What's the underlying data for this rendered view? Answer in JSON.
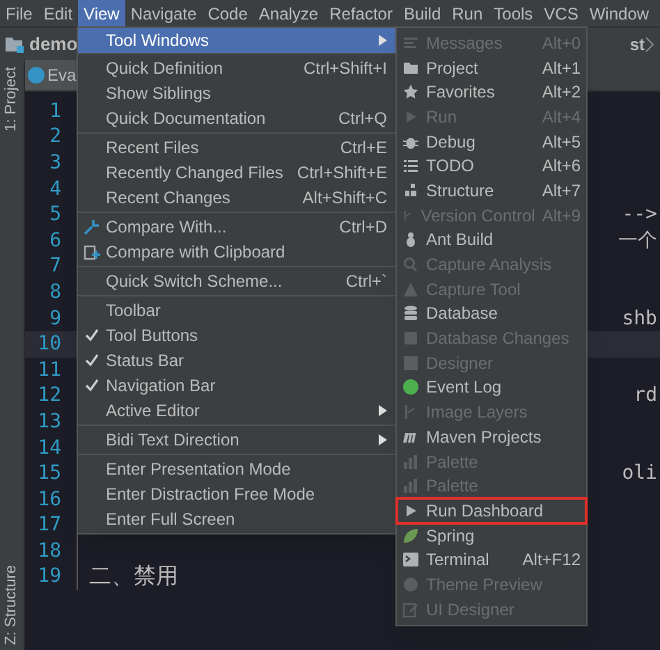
{
  "menu_bar": [
    {
      "label": "File",
      "selected": false
    },
    {
      "label": "Edit",
      "selected": false
    },
    {
      "label": "View",
      "selected": true
    },
    {
      "label": "Navigate",
      "selected": false
    },
    {
      "label": "Code",
      "selected": false
    },
    {
      "label": "Analyze",
      "selected": false
    },
    {
      "label": "Refactor",
      "selected": false
    },
    {
      "label": "Build",
      "selected": false
    },
    {
      "label": "Run",
      "selected": false
    },
    {
      "label": "Tools",
      "selected": false
    },
    {
      "label": "VCS",
      "selected": false
    },
    {
      "label": "Window",
      "selected": false
    }
  ],
  "toolbar": {
    "project": "demo",
    "breadcrumb": "st"
  },
  "side_tabs": {
    "top": "1: Project",
    "bottom": "Z: Structure"
  },
  "editor_tab": {
    "label": "Eva"
  },
  "code_lines": [
    {
      "number": "1",
      "current": false
    },
    {
      "number": "2",
      "current": false
    },
    {
      "number": "3",
      "current": false
    },
    {
      "number": "4",
      "current": false
    },
    {
      "number": "5",
      "text": "-->",
      "current": false,
      "kind": "tail"
    },
    {
      "number": "6",
      "text": "一个",
      "current": false,
      "kind": "tail"
    },
    {
      "number": "7",
      "current": false
    },
    {
      "number": "8",
      "current": false
    },
    {
      "number": "9",
      "text": "shb",
      "current": false,
      "kind": "tail"
    },
    {
      "number": "10",
      "current": true
    },
    {
      "number": "11",
      "current": false
    },
    {
      "number": "12",
      "text": "rd",
      "current": false,
      "kind": "tail"
    },
    {
      "number": "13",
      "current": false
    },
    {
      "number": "14",
      "current": false
    },
    {
      "number": "15",
      "text": "oli",
      "current": false,
      "kind": "tail"
    },
    {
      "number": "16",
      "current": false
    },
    {
      "number": "17",
      "current": false
    },
    {
      "number": "18",
      "current": false
    },
    {
      "number": "19",
      "text": "二、禁用",
      "current": false,
      "kind": "text"
    }
  ],
  "view_menu": [
    [
      {
        "label": "Tool Windows",
        "selected": true,
        "submenu": true
      }
    ],
    [
      {
        "label": "Quick Definition",
        "shortcut": "Ctrl+Shift+I"
      },
      {
        "label": "Show Siblings"
      },
      {
        "label": "Quick Documentation",
        "shortcut": "Ctrl+Q"
      }
    ],
    [
      {
        "label": "Recent Files",
        "shortcut": "Ctrl+E"
      },
      {
        "label": "Recently Changed Files",
        "shortcut": "Ctrl+Shift+E"
      },
      {
        "label": "Recent Changes",
        "shortcut": "Alt+Shift+C"
      }
    ],
    [
      {
        "label": "Compare With...",
        "shortcut": "Ctrl+D"
      },
      {
        "label": "Compare with Clipboard"
      }
    ],
    [
      {
        "label": "Quick Switch Scheme...",
        "shortcut": "Ctrl+`"
      }
    ],
    [
      {
        "label": "Toolbar",
        "checked": false
      },
      {
        "label": "Tool Buttons",
        "checked": true
      },
      {
        "label": "Status Bar",
        "checked": true
      },
      {
        "label": "Navigation Bar",
        "checked": true
      },
      {
        "label": "Active Editor",
        "submenu": true
      }
    ],
    [
      {
        "label": "Bidi Text Direction",
        "submenu": true
      }
    ],
    [
      {
        "label": "Enter Presentation Mode"
      },
      {
        "label": "Enter Distraction Free Mode"
      },
      {
        "label": "Enter Full Screen"
      }
    ]
  ],
  "tool_windows": [
    {
      "label": "Messages",
      "shortcut": "Alt+0",
      "disabled": true
    },
    {
      "label": "Project",
      "shortcut": "Alt+1",
      "disabled": false
    },
    {
      "label": "Favorites",
      "shortcut": "Alt+2",
      "disabled": false
    },
    {
      "label": "Run",
      "shortcut": "Alt+4",
      "disabled": true
    },
    {
      "label": "Debug",
      "shortcut": "Alt+5",
      "disabled": false
    },
    {
      "label": "TODO",
      "shortcut": "Alt+6",
      "disabled": false
    },
    {
      "label": "Structure",
      "shortcut": "Alt+7",
      "disabled": false
    },
    {
      "label": "Version Control",
      "shortcut": "Alt+9",
      "disabled": true
    },
    {
      "label": "Ant Build",
      "disabled": false
    },
    {
      "label": "Capture Analysis",
      "disabled": true
    },
    {
      "label": "Capture Tool",
      "disabled": true
    },
    {
      "label": "Database",
      "disabled": false
    },
    {
      "label": "Database Changes",
      "disabled": true
    },
    {
      "label": "Designer",
      "disabled": true
    },
    {
      "label": "Event Log",
      "disabled": false
    },
    {
      "label": "Image Layers",
      "disabled": true
    },
    {
      "label": "Maven Projects",
      "disabled": false
    },
    {
      "label": "Palette",
      "disabled": true
    },
    {
      "label": "Palette",
      "disabled": true
    },
    {
      "label": "Run Dashboard",
      "disabled": false,
      "highlighted": true
    },
    {
      "label": "Spring",
      "disabled": false
    },
    {
      "label": "Terminal",
      "shortcut": "Alt+F12",
      "disabled": false
    },
    {
      "label": "Theme Preview",
      "disabled": true
    },
    {
      "label": "UI Designer",
      "disabled": true
    }
  ]
}
